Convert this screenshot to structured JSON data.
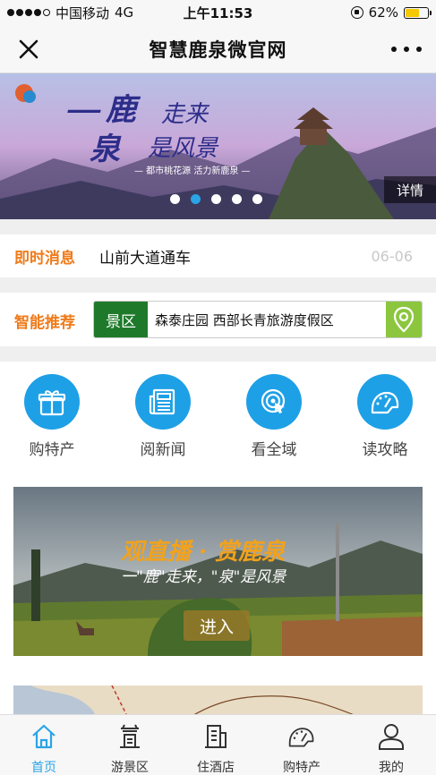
{
  "status": {
    "carrier": "中国移动",
    "network": "4G",
    "time": "上午11:53",
    "battery": "62%",
    "battery_level": 0.62
  },
  "navbar": {
    "title": "智慧鹿泉微官网"
  },
  "banner": {
    "detail_label": "详情",
    "slide_count": 5,
    "active_slide": 1
  },
  "news": {
    "label": "即时消息",
    "headline": "山前大道通车",
    "date": "06-06"
  },
  "recommend": {
    "label": "智能推荐",
    "tag": "景区",
    "places": "森泰庄园  西部长青旅游度假区"
  },
  "grid": {
    "items": [
      {
        "label": "购特产",
        "icon": "gift-icon"
      },
      {
        "label": "阅新闻",
        "icon": "newspaper-icon"
      },
      {
        "label": "看全域",
        "icon": "target-icon"
      },
      {
        "label": "读攻略",
        "icon": "gauge-icon"
      }
    ]
  },
  "live": {
    "enter_label": "进入"
  },
  "tabbar": {
    "items": [
      {
        "label": "首页",
        "icon": "home-icon",
        "active": true
      },
      {
        "label": "游景区",
        "icon": "scenic-icon",
        "active": false
      },
      {
        "label": "住酒店",
        "icon": "hotel-icon",
        "active": false
      },
      {
        "label": "购特产",
        "icon": "gauge-icon",
        "active": false
      },
      {
        "label": "我的",
        "icon": "user-icon",
        "active": false
      }
    ]
  },
  "colors": {
    "accent": "#1ea0e6",
    "orange": "#ef7b1a",
    "tag_green": "#1e7a2a",
    "location_green": "#8cc63f"
  }
}
